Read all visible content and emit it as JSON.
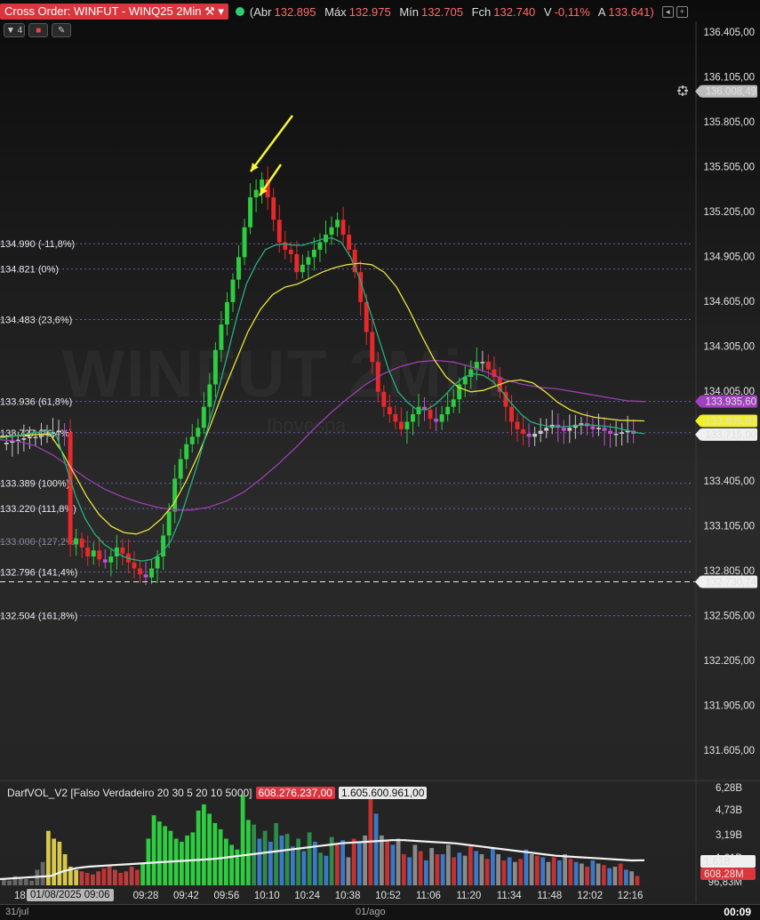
{
  "header": {
    "title": "Cross Order: WINFUT - WINQ25 2Min",
    "ohlc": [
      {
        "label": "Abr",
        "value": "132.895"
      },
      {
        "label": "Máx",
        "value": "132.975"
      },
      {
        "label": "Mín",
        "value": "132.705"
      },
      {
        "label": "Fch",
        "value": "132.740"
      },
      {
        "label": "V",
        "value": "-0,11%"
      },
      {
        "label": "A",
        "value": "133.641)"
      }
    ],
    "open_paren": "(",
    "toolbar_count": "4"
  },
  "watermark": {
    "main": "WINFUT 2Min",
    "sub": "Ibovespa"
  },
  "colors": {
    "up": "#2ecc40",
    "down": "#e8282b",
    "doji_up": "#c9c9c9",
    "doji_down": "#c050d0",
    "ema_fast": "#26b07a",
    "sma_mid": "#e8e23a",
    "sma_slow": "#9a3fb0",
    "fib_line": "#7b6fdc",
    "arrow": "#f5f53a"
  },
  "chart_data": {
    "type": "candlestick",
    "title": "Cross Order: WINFUT - WINQ25 2Min",
    "y_axis": {
      "range": [
        131405,
        136505
      ],
      "ticks": [
        "136.405,00",
        "136.105,00",
        "135.805,00",
        "135.505,00",
        "135.205,00",
        "134.905,00",
        "134.605,00",
        "134.305,00",
        "134.005,00",
        "133.705,00",
        "133.405,00",
        "133.105,00",
        "132.805,00",
        "132.505,00",
        "132.205,00",
        "131.905,00",
        "131.605,00"
      ]
    },
    "x_axis": {
      "ticks": [
        "09:28",
        "09:42",
        "09:56",
        "10:10",
        "10:24",
        "10:38",
        "10:52",
        "11:06",
        "11:20",
        "11:34",
        "11:48",
        "12:02",
        "12:16"
      ],
      "day_labels": [
        "31/jul",
        "01/ago"
      ]
    },
    "price_tags": [
      {
        "label": "136.008,49",
        "value": 136008.49,
        "style": "gray"
      },
      {
        "label": "133.935,60",
        "value": 133935.6,
        "style": "purple"
      },
      {
        "label": "133.805,92",
        "value": 133805.92,
        "style": "yellow"
      },
      {
        "label": "133.715,00",
        "value": 133715.0,
        "style": "white"
      },
      {
        "label": "132.730,74",
        "value": 132730.74,
        "style": "white"
      }
    ],
    "fibonacci": [
      {
        "label": "134.990 (-11,8%)",
        "value": 134990
      },
      {
        "label": "134.821 (0%)",
        "value": 134821
      },
      {
        "label": "134.483 (23,6%)",
        "value": 134483
      },
      {
        "label": "133.936 (61,8%)",
        "value": 133936
      },
      {
        "label": "133.727 (76,4%)",
        "value": 133727
      },
      {
        "label": "133.389 (100%)",
        "value": 133389
      },
      {
        "label": "133.220 (111,8%)",
        "value": 133220
      },
      {
        "label": "133.000 (127,2%)",
        "value": 133000
      },
      {
        "label": "132.796 (141,4%)",
        "value": 132796
      },
      {
        "label": "132.504 (161,8%)",
        "value": 132504
      }
    ],
    "candles_close": [
      133660,
      133670,
      133680,
      133690,
      133700,
      133700,
      133710,
      133720,
      133730,
      133740,
      133730,
      132980,
      133020,
      132960,
      132900,
      132940,
      132880,
      132860,
      132900,
      132960,
      132920,
      132860,
      132820,
      132780,
      132760,
      132820,
      132900,
      133040,
      133200,
      133420,
      133550,
      133650,
      133700,
      133760,
      133900,
      134050,
      134280,
      134450,
      134600,
      134750,
      134900,
      135100,
      135300,
      135350,
      135420,
      135300,
      135150,
      135000,
      134950,
      134920,
      134800,
      134850,
      134900,
      134950,
      135000,
      135050,
      135100,
      135150,
      135050,
      134950,
      134800,
      134600,
      134400,
      134200,
      134000,
      133900,
      133850,
      133800,
      133750,
      133800,
      133850,
      133900,
      133880,
      133820,
      133800,
      133850,
      133900,
      133950,
      134050,
      134100,
      134150,
      134200,
      134200,
      134150,
      134100,
      134000,
      133900,
      133800,
      133750,
      133720,
      133700,
      133720,
      133740,
      133760,
      133780,
      133760,
      133740,
      133760,
      133780,
      133790,
      133770,
      133750,
      133760,
      133740,
      133720,
      133720,
      133730,
      133740,
      133720
    ],
    "ema_fast": [
      133690,
      133700,
      133710,
      133720,
      133730,
      133740,
      133700,
      133500,
      133300,
      133150,
      133050,
      132980,
      132940,
      132900,
      132880,
      132870,
      132880,
      132920,
      133000,
      133150,
      133350,
      133550,
      133780,
      134000,
      134250,
      134500,
      134720,
      134850,
      134950,
      134980,
      134990,
      134980,
      134980,
      135000,
      135020,
      135030,
      135000,
      134900,
      134750,
      134550,
      134350,
      134150,
      134000,
      133930,
      133880,
      133880,
      133920,
      133980,
      134050,
      134100,
      134120,
      134110,
      134070,
      134000,
      133920,
      133850,
      133800,
      133780,
      133770,
      133765,
      133770,
      133775,
      133780,
      133775,
      133770,
      133760,
      133745,
      133730,
      133720
    ],
    "sma_mid": [
      133700,
      133705,
      133710,
      133715,
      133720,
      133600,
      133450,
      133300,
      133180,
      133100,
      133060,
      133050,
      133080,
      133150,
      133250,
      133400,
      133580,
      133780,
      134000,
      134200,
      134400,
      134550,
      134650,
      134700,
      134720,
      134760,
      134800,
      134830,
      134850,
      134860,
      134850,
      134800,
      134700,
      134550,
      134380,
      134220,
      134100,
      134030,
      134000,
      134010,
      134040,
      134070,
      134080,
      134060,
      134000,
      133930,
      133880,
      133850,
      133830,
      133820,
      133810,
      133808,
      133806
    ],
    "sma_slow": [
      133680,
      133670,
      133640,
      133580,
      133500,
      133420,
      133350,
      133300,
      133260,
      133230,
      133210,
      133210,
      133230,
      133270,
      133330,
      133420,
      133520,
      133630,
      133750,
      133860,
      133960,
      134050,
      134120,
      134170,
      134200,
      134210,
      134200,
      134170,
      134130,
      134080,
      134050,
      134030,
      134020,
      134000,
      133980,
      133960,
      133940,
      133935
    ],
    "volume": {
      "indicator": "DarfVOL_V2 [Falso Verdadeiro 20 30 5 20 10 5000]",
      "last_value": "608.276.237,00",
      "avg_value": "1.605.600.961,00",
      "y_ticks": [
        "6,28B",
        "4,73B",
        "3,19B",
        "1,61B",
        "96,83M"
      ],
      "tags": [
        {
          "label": "1,61B",
          "style": "white"
        },
        {
          "label": "608,28M",
          "style": "red"
        }
      ],
      "bars_billions": [
        0.4,
        0.3,
        0.6,
        0.5,
        0.4,
        0.3,
        1.0,
        1.5,
        3.5,
        3.0,
        2.8,
        2.0,
        1.2,
        1.0,
        0.9,
        0.8,
        0.7,
        0.9,
        1.1,
        1.3,
        1.0,
        0.8,
        0.9,
        1.2,
        1.0,
        1.4,
        3.0,
        4.5,
        4.1,
        3.8,
        3.5,
        3.0,
        2.8,
        3.2,
        3.4,
        4.8,
        5.2,
        4.6,
        4.0,
        3.6,
        3.0,
        2.6,
        2.3,
        5.8,
        4.2,
        3.9,
        3.0,
        3.5,
        2.8,
        4.0,
        3.2,
        3.3,
        2.5,
        3.0,
        2.2,
        3.4,
        2.8,
        2.1,
        1.9,
        3.1,
        2.7,
        2.9,
        1.8,
        3.0,
        2.8,
        3.2,
        5.8,
        4.6,
        3.2,
        2.9,
        2.6,
        3.0,
        2.0,
        1.8,
        2.6,
        2.2,
        1.6,
        2.4,
        2.0,
        2.0,
        2.6,
        1.8,
        2.1,
        1.9,
        2.5,
        2.2,
        2.0,
        1.7,
        2.4,
        2.0,
        1.6,
        1.8,
        1.5,
        1.7,
        2.3,
        2.0,
        1.9,
        1.8,
        1.5,
        1.8,
        1.6,
        2.0,
        1.7,
        1.5,
        1.4,
        1.2,
        1.6,
        1.4,
        1.3,
        1.1,
        1.2,
        1.4,
        1.0,
        0.9,
        0.6
      ],
      "avg_line_billions": [
        0.4,
        0.45,
        0.5,
        0.55,
        0.6,
        0.9,
        1.1,
        1.2,
        1.25,
        1.3,
        1.35,
        1.4,
        1.45,
        1.5,
        1.55,
        1.6,
        1.65,
        1.7,
        1.8,
        1.9,
        2.0,
        2.1,
        2.2,
        2.3,
        2.4,
        2.5,
        2.6,
        2.7,
        2.75,
        2.8,
        2.85,
        2.9,
        2.9,
        2.85,
        2.8,
        2.75,
        2.7,
        2.6,
        2.5,
        2.4,
        2.3,
        2.2,
        2.1,
        2.0,
        1.9,
        1.85,
        1.8,
        1.75,
        1.7,
        1.65,
        1.6,
        1.61
      ]
    }
  },
  "footer": {
    "date_tooltip": "01/08/2025 09:06",
    "clock": "00:09",
    "day_left": "31/jul",
    "day_right": "01/ago",
    "x_first_partial": "18:"
  }
}
